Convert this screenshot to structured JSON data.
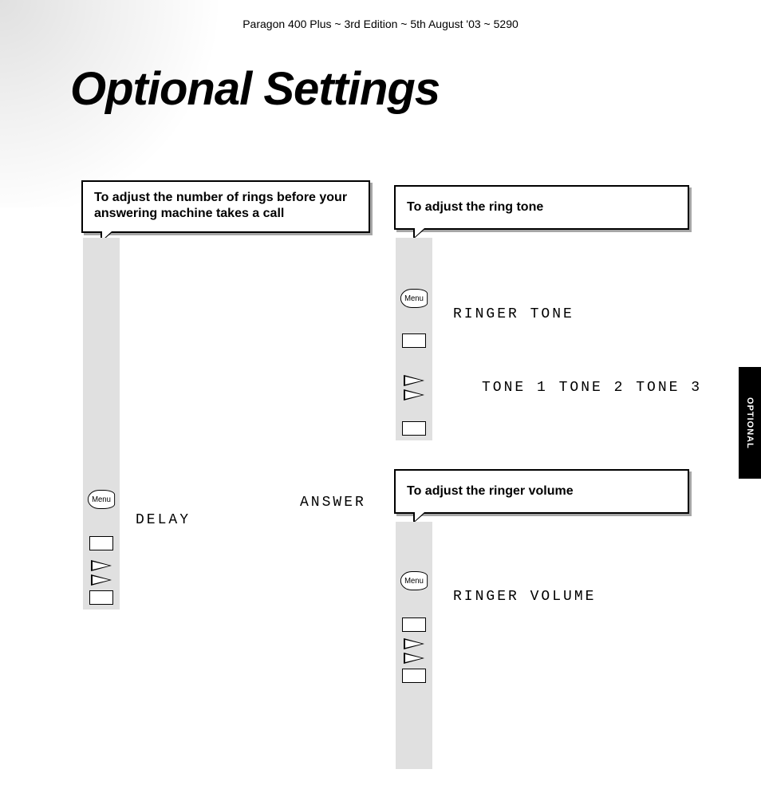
{
  "header": "Paragon 400 Plus ~ 3rd Edition ~ 5th August '03 ~ 5290",
  "title": "Optional Settings",
  "side_tab": "OPTIONAL",
  "menu_label": "Menu",
  "callouts": {
    "answer_delay": "To adjust the number of rings before your answering machine takes a call",
    "ring_tone": "To adjust the ring tone",
    "ringer_volume": "To adjust the ringer volume"
  },
  "lcd": {
    "answer": "ANSWER",
    "delay": "DELAY",
    "ringer_tone": "RINGER TONE",
    "tone_options": "TONE 1 TONE 2  TONE 3",
    "ringer_volume": "RINGER VOLUME"
  }
}
